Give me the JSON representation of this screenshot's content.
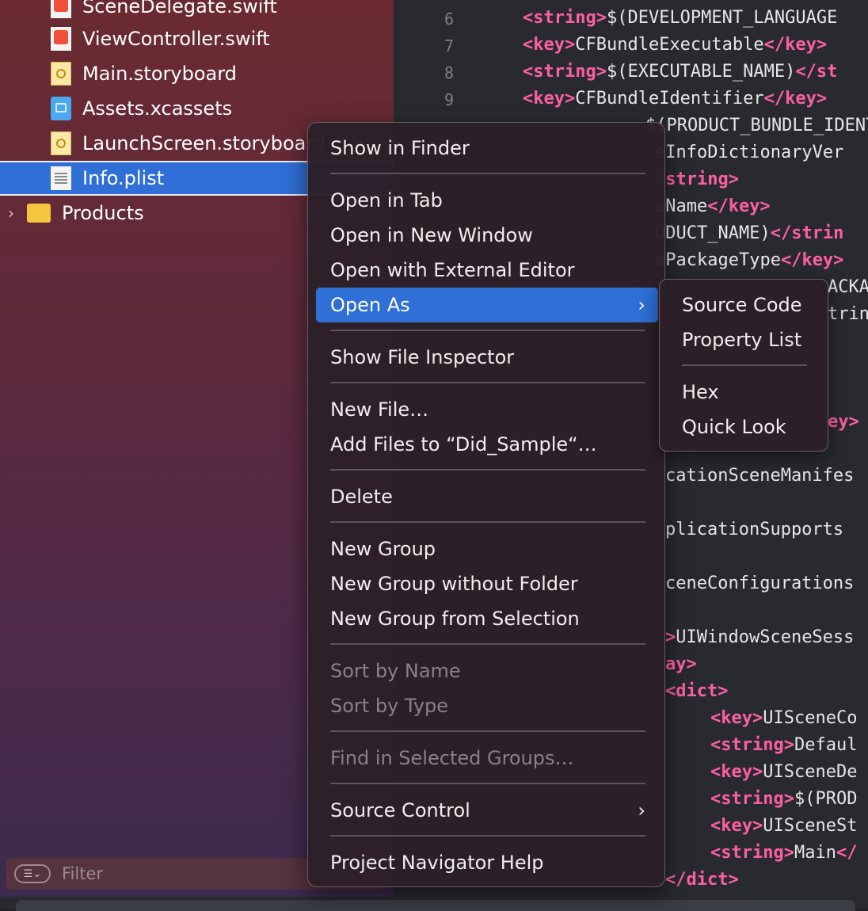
{
  "navigator": {
    "items": [
      {
        "label": "SceneDelegate.swift",
        "icon": "swift-file-icon"
      },
      {
        "label": "ViewController.swift",
        "icon": "swift-file-icon"
      },
      {
        "label": "Main.storyboard",
        "icon": "storyboard-file-icon"
      },
      {
        "label": "Assets.xcassets",
        "icon": "asset-catalog-icon"
      },
      {
        "label": "LaunchScreen.storyboard",
        "icon": "storyboard-file-icon"
      },
      {
        "label": "Info.plist",
        "icon": "plist-file-icon",
        "selected": true
      },
      {
        "label": "Products",
        "icon": "folder-icon"
      }
    ],
    "filter_placeholder": "Filter"
  },
  "editor": {
    "line_numbers": [
      "6",
      "7",
      "8",
      "9"
    ],
    "lines": [
      {
        "tag_open": "<string>",
        "text": "$(DEVELOPMENT_LANGUAGE"
      },
      {
        "tag_open": "<key>",
        "text": "CFBundleExecutable",
        "tag_close": "</key>"
      },
      {
        "tag_open": "<string>",
        "text": "$(EXECUTABLE_NAME)",
        "tag_close": "</st"
      },
      {
        "tag_open": "<key>",
        "text": "CFBundleIdentifier",
        "tag_close": "</key>"
      },
      {
        "text": "$(PRODUCT_BUNDLE_IDENT"
      },
      {
        "text": "eInfoDictionaryVer"
      },
      {
        "tag_close": "/string>"
      },
      {
        "text": "eName",
        "tag_close": "</key>"
      },
      {
        "text": "ODUCT_NAME)",
        "tag_close": "</strin"
      },
      {
        "text": "ePackageType",
        "tag_close": "</key>"
      },
      {
        "text": "ACKA"
      },
      {
        "text": "trin"
      },
      {
        "tag_close": "ey>"
      },
      {
        "text": "cationSceneManifes"
      },
      {
        "text": "plicationSupports"
      },
      {
        "text": "ceneConfigurations"
      },
      {
        "tag_close": ">",
        "text": "UIWindowSceneSess"
      },
      {
        "tag_close": "ay>"
      },
      {
        "tag_close": "<dict>"
      },
      {
        "tag_open": "<key>",
        "text": "UISceneCo"
      },
      {
        "tag_open": "<string>",
        "text": "Defaul"
      },
      {
        "tag_open": "<key>",
        "text": "UISceneDe"
      },
      {
        "tag_open": "<string>",
        "text": "$(PROD"
      },
      {
        "tag_open": "<key>",
        "text": "UISceneSt"
      },
      {
        "tag_open": "<string>",
        "text": "Main",
        "tag_close": "</"
      },
      {
        "tag_close": "</dict>"
      }
    ]
  },
  "context_menu": {
    "items": [
      {
        "label": "Show in Finder"
      },
      {
        "label": "Open in Tab"
      },
      {
        "label": "Open in New Window"
      },
      {
        "label": "Open with External Editor"
      },
      {
        "label": "Open As",
        "highlighted": true,
        "submenu_arrow": "›"
      },
      {
        "label": "Show File Inspector"
      },
      {
        "label": "New File…"
      },
      {
        "label": "Add Files to “Did_Sample“…"
      },
      {
        "label": "Delete"
      },
      {
        "label": "New Group"
      },
      {
        "label": "New Group without Folder"
      },
      {
        "label": "New Group from Selection"
      },
      {
        "label": "Sort by Name",
        "disabled": true
      },
      {
        "label": "Sort by Type",
        "disabled": true
      },
      {
        "label": "Find in Selected Groups…",
        "disabled": true
      },
      {
        "label": "Source Control",
        "submenu_arrow": "›"
      },
      {
        "label": "Project Navigator Help"
      }
    ]
  },
  "open_as_submenu": {
    "items": [
      {
        "label": "Source Code"
      },
      {
        "label": "Property List"
      },
      {
        "label": "Hex"
      },
      {
        "label": "Quick Look"
      }
    ]
  },
  "colors": {
    "selection": "#2f6fd6",
    "xml_tag": "#fc5fa3",
    "editor_bg": "#292a30"
  }
}
